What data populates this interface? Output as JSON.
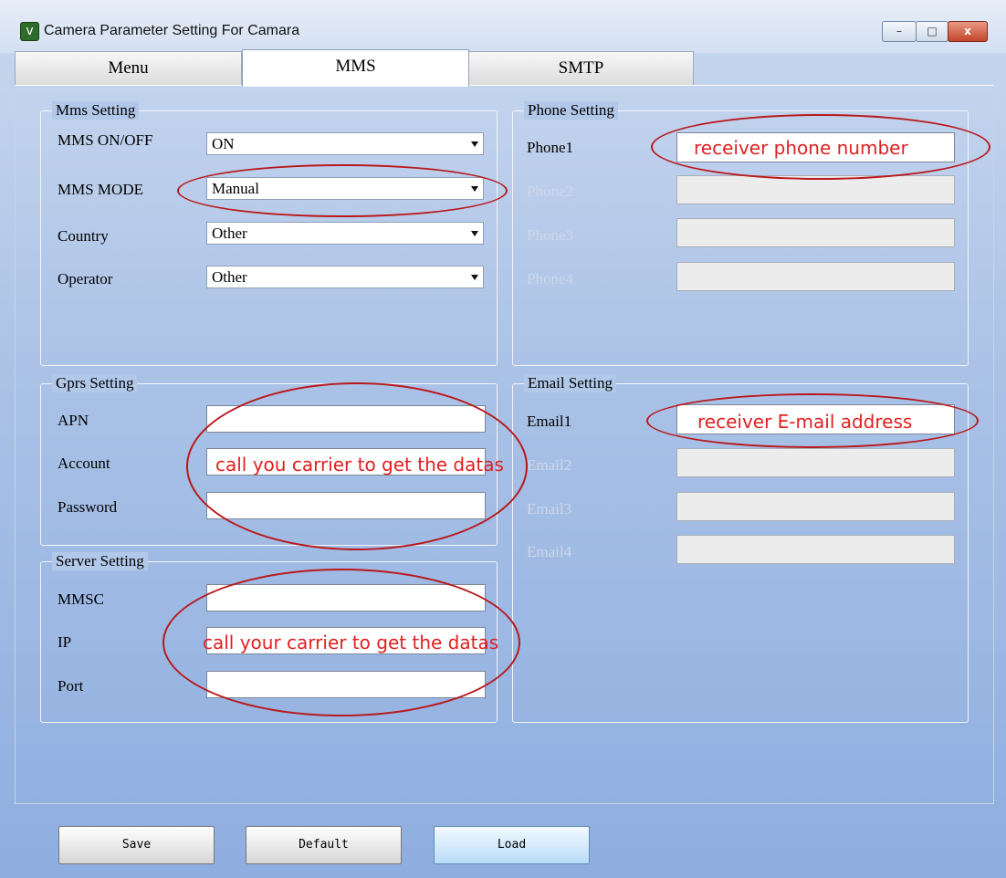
{
  "window": {
    "title": "Camera Parameter Setting For  Camara",
    "minimize": "–",
    "maximize": "□",
    "close": "x",
    "app_icon": "v"
  },
  "tabs": [
    {
      "label": "Menu"
    },
    {
      "label": "MMS"
    },
    {
      "label": "SMTP"
    }
  ],
  "mms_setting": {
    "title": "Mms Setting",
    "rows": [
      {
        "label": "MMS ON/OFF",
        "value": "ON"
      },
      {
        "label": "MMS MODE",
        "value": "Manual"
      },
      {
        "label": "Country",
        "value": "Other"
      },
      {
        "label": "Operator",
        "value": "Other"
      }
    ]
  },
  "phone_setting": {
    "title": "Phone Setting",
    "rows": [
      {
        "label": "Phone1"
      },
      {
        "label": "Phone2"
      },
      {
        "label": "Phone3"
      },
      {
        "label": "Phone4"
      }
    ]
  },
  "gprs_setting": {
    "title": "Gprs Setting",
    "rows": [
      {
        "label": "APN"
      },
      {
        "label": "Account"
      },
      {
        "label": "Password"
      }
    ]
  },
  "email_setting": {
    "title": "Email Setting",
    "rows": [
      {
        "label": "Email1"
      },
      {
        "label": "Email2"
      },
      {
        "label": "Email3"
      },
      {
        "label": "Email4"
      }
    ]
  },
  "server_setting": {
    "title": "Server Setting",
    "rows": [
      {
        "label": "MMSC"
      },
      {
        "label": "IP"
      },
      {
        "label": "Port"
      }
    ]
  },
  "annotations": {
    "phone": "receiver phone number",
    "email": "receiver E-mail address",
    "gprs": "call you carrier to get the datas",
    "server": "call your carrier to get the datas"
  },
  "buttons": {
    "save": "Save",
    "default": "Default",
    "load": "Load"
  },
  "colors": {
    "annotation": "#e02020",
    "ellipse": "#b9181a"
  }
}
